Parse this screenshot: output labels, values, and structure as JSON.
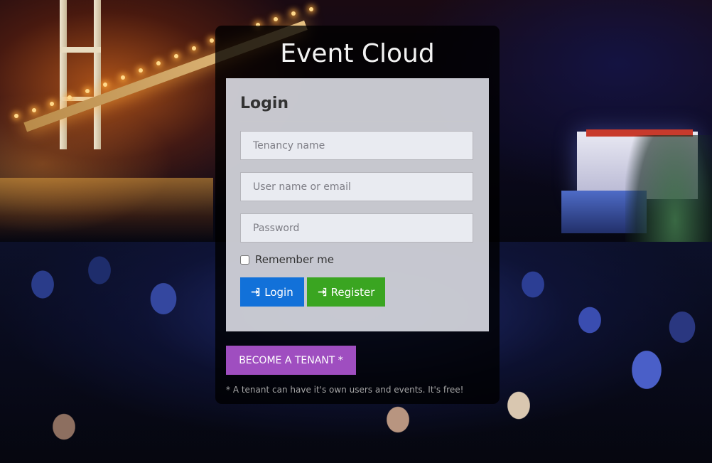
{
  "app": {
    "title": "Event Cloud"
  },
  "login_form": {
    "title": "Login",
    "tenancy_placeholder": "Tenancy name",
    "username_placeholder": "User name or email",
    "password_placeholder": "Password",
    "remember_me_label": "Remember me",
    "remember_me_checked": false,
    "login_button_label": "Login",
    "login_button_icon": "sign-in-icon",
    "register_button_label": "Register",
    "register_button_icon": "sign-in-icon"
  },
  "tenant": {
    "button_label": "BECOME A TENANT *",
    "note": "* A tenant can have it's own users and events. It's free!"
  },
  "colors": {
    "login_button": "#1271d9",
    "register_button": "#3aa521",
    "tenant_button": "#9f4ec0"
  }
}
